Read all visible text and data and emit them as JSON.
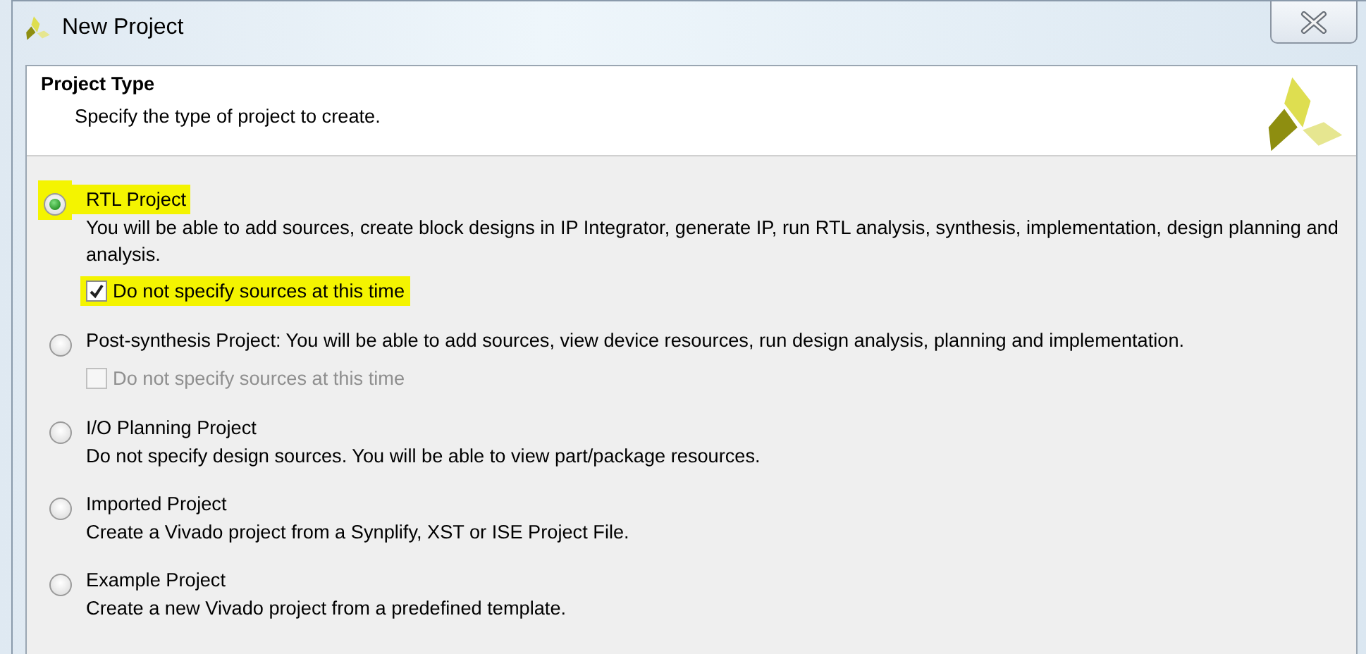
{
  "window": {
    "title": "New Project"
  },
  "header": {
    "title": "Project Type",
    "subtitle": "Specify the type of project to create."
  },
  "options": [
    {
      "label": "RTL Project",
      "description": "You will be able to add sources, create block designs in IP Integrator, generate IP, run RTL analysis, synthesis, implementation, design planning and analysis.",
      "selected": true,
      "highlighted": true,
      "sub_option": {
        "label": "Do not specify sources at this time",
        "checked": true,
        "disabled": false,
        "highlighted": true
      }
    },
    {
      "label": "Post-synthesis Project: You will be able to add sources, view device resources, run design analysis, planning and implementation.",
      "selected": false,
      "highlighted": false,
      "sub_option": {
        "label": "Do not specify sources at this time",
        "checked": false,
        "disabled": true,
        "highlighted": false
      }
    },
    {
      "label": "I/O Planning Project",
      "description": "Do not specify design sources. You will be able to view part/package resources.",
      "selected": false,
      "highlighted": false
    },
    {
      "label": "Imported Project",
      "description": "Create a Vivado project from a Synplify, XST or ISE Project File.",
      "selected": false,
      "highlighted": false
    },
    {
      "label": "Example Project",
      "description": "Create a new Vivado project from a predefined template.",
      "selected": false,
      "highlighted": false
    }
  ]
}
